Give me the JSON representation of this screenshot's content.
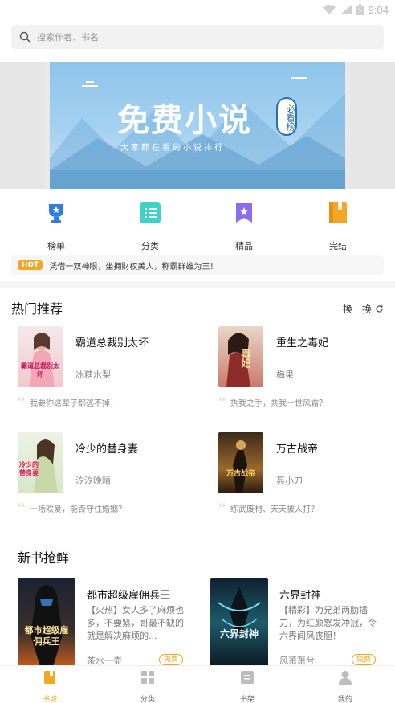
{
  "status_bar": {
    "time": "9:04"
  },
  "search": {
    "placeholder": "搜索作者、书名"
  },
  "banner": {
    "title": "免费小说",
    "badge": "必看榜",
    "subtitle": "大家都在看的小说排行"
  },
  "quick_nav": [
    {
      "label": "榜单",
      "icon": "trophy-icon"
    },
    {
      "label": "分类",
      "icon": "list-icon"
    },
    {
      "label": "精品",
      "icon": "bookmark-star-icon"
    },
    {
      "label": "完结",
      "icon": "book-icon"
    }
  ],
  "notice": {
    "badge": "HOT",
    "text": "凭借一双神眼，坐拥财权美人，称霸群雄为王！"
  },
  "hot": {
    "title": "热门推荐",
    "refresh_label": "换一换",
    "books": [
      {
        "name": "霸道总裁别太坏",
        "author": "冰糖水梨",
        "quote": "我要你这辈子都逃不掉！",
        "cover_text": "霸道总裁别太坏"
      },
      {
        "name": "重生之毒妃",
        "author": "梅果",
        "quote": "执我之手，共我一世风霜？",
        "cover_text": "毒妃"
      },
      {
        "name": "冷少的替身妻",
        "author": "汐汐晚晴",
        "quote": "一场欢爱，能否守住婚姻？",
        "cover_text": "冷少的替身妻"
      },
      {
        "name": "万古战帝",
        "author": "聂小刀",
        "quote": "练武废材、天天被人打？",
        "cover_text": "万古战帝"
      }
    ]
  },
  "new_books": {
    "title": "新书抢鲜",
    "books": [
      {
        "name": "都市超级雇佣兵王",
        "intro": "【火热】女人多了麻烦也多，不要紧，哥最不缺的就是解决麻烦的...",
        "author": "茶水一壶",
        "tag": "免费",
        "cover_text": "都市超级雇佣兵王"
      },
      {
        "name": "六界封神",
        "intro": "【精彩】为兄弟两肋插刀，为红颜怒发冲冠，令六界闻风丧胆！",
        "author": "风萧萧兮",
        "tag": "免费",
        "cover_text": "六界封神"
      }
    ]
  },
  "tabbar": [
    {
      "label": "书城",
      "icon": "bookstore-icon",
      "active": true
    },
    {
      "label": "分类",
      "icon": "grid-icon",
      "active": false
    },
    {
      "label": "书架",
      "icon": "bookshelf-icon",
      "active": false
    },
    {
      "label": "我的",
      "icon": "user-icon",
      "active": false
    }
  ],
  "colors": {
    "accent": "#f5a623",
    "teal": "#3fd2c7",
    "purple": "#8a6cf0",
    "blue_banner": "#8ec4ea"
  }
}
